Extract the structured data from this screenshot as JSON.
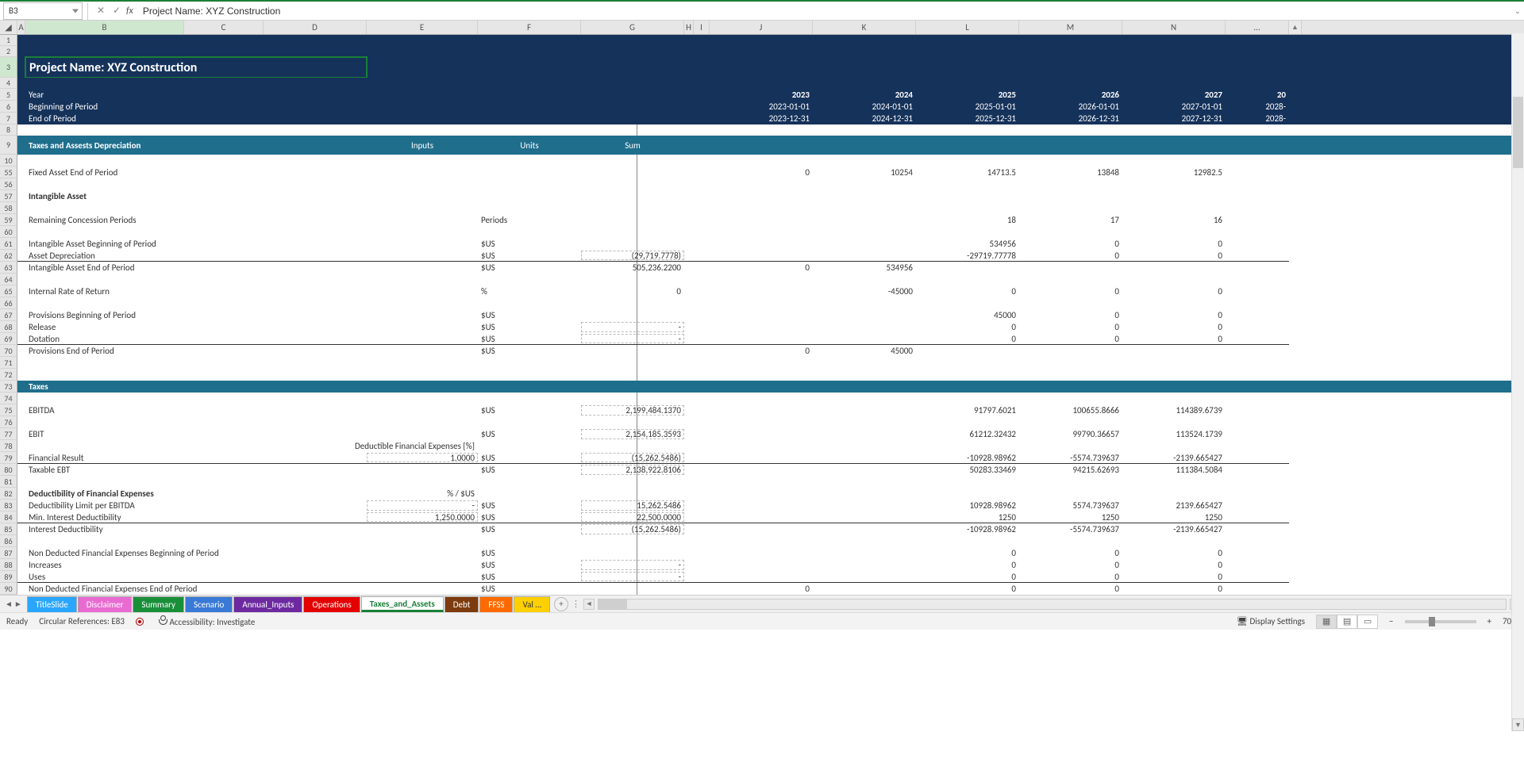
{
  "name_box": "B3",
  "formula_text": "Project Name: XYZ Construction",
  "columns": [
    "",
    "A",
    "B",
    "C",
    "D",
    "E",
    "F",
    "G",
    "H",
    "I",
    "J",
    "K",
    "L",
    "M",
    "N",
    "…"
  ],
  "header_block": {
    "title": "Project Name: XYZ Construction",
    "year_label": "Year",
    "bop_label": "Beginning of Period",
    "eop_label": "End of Period",
    "years": [
      "2023",
      "2024",
      "2025",
      "2026",
      "2027",
      "20"
    ],
    "bop": [
      "2023-01-01",
      "2024-01-01",
      "2025-01-01",
      "2026-01-01",
      "2027-01-01",
      "2028-"
    ],
    "eop": [
      "2023-12-31",
      "2024-12-31",
      "2025-12-31",
      "2026-12-31",
      "2027-12-31",
      "2028-"
    ]
  },
  "section_row": {
    "label": "Taxes and Assests Depreciation",
    "inputs": "Inputs",
    "units": "Units",
    "sum": "Sum"
  },
  "row_nums_top": [
    "1",
    "2",
    "3",
    "4",
    "5",
    "6",
    "7"
  ],
  "rows": [
    {
      "rn": "9"
    },
    {
      "rn": "10"
    },
    {
      "rn": "55",
      "b": "Fixed Asset End of Period",
      "j": "0",
      "k": "10254",
      "l": "14713.5",
      "m": "13848",
      "n": "12982.5"
    },
    {
      "rn": "56"
    },
    {
      "rn": "57",
      "b": "Intangible Asset",
      "bold": true
    },
    {
      "rn": "58"
    },
    {
      "rn": "59",
      "b": "Remaining Concession Periods",
      "f": "Periods",
      "l": "18",
      "m": "17",
      "n": "16"
    },
    {
      "rn": "60"
    },
    {
      "rn": "61",
      "b": "Intangible Asset Beginning of Period",
      "f": "$US",
      "l": "534956",
      "m": "0",
      "n": "0"
    },
    {
      "rn": "62",
      "b": "Asset Depreciation",
      "f": "$US",
      "g": "(29,719.7778)",
      "g_dot": true,
      "l": "-29719.77778",
      "m": "0",
      "n": "0",
      "underline": true
    },
    {
      "rn": "63",
      "b": "Intangible Asset End of Period",
      "f": "$US",
      "g": "505,236.2200",
      "j": "0",
      "k": "534956"
    },
    {
      "rn": "64"
    },
    {
      "rn": "65",
      "b": "Internal Rate of Return",
      "f": "%",
      "g": "0",
      "k": "-45000",
      "l": "0",
      "m": "0",
      "n": "0"
    },
    {
      "rn": "66"
    },
    {
      "rn": "67",
      "b": "Provisions Beginning of Period",
      "f": "$US",
      "l": "45000",
      "m": "0",
      "n": "0"
    },
    {
      "rn": "68",
      "b": "Release",
      "f": "$US",
      "g": "-",
      "g_dot": true,
      "l": "0",
      "m": "0",
      "n": "0"
    },
    {
      "rn": "69",
      "b": "Dotation",
      "f": "$US",
      "g": "-",
      "g_dot": true,
      "l": "0",
      "m": "0",
      "n": "0",
      "underline": true
    },
    {
      "rn": "70",
      "b": "Provisions End of Period",
      "f": "$US",
      "j": "0",
      "k": "45000"
    },
    {
      "rn": "71"
    },
    {
      "rn": "72"
    },
    {
      "rn": "73",
      "b": "Taxes",
      "teal": true
    },
    {
      "rn": "74"
    },
    {
      "rn": "75",
      "b": "EBITDA",
      "f": "$US",
      "g": "2,199,484.1370",
      "g_dot": true,
      "l": "91797.6021",
      "m": "100655.8666",
      "n": "114389.6739"
    },
    {
      "rn": "76"
    },
    {
      "rn": "77",
      "b": "EBIT",
      "f": "$US",
      "g": "2,154,185.3593",
      "g_dot": true,
      "l": "61212.32432",
      "m": "99790.36657",
      "n": "113524.1739"
    },
    {
      "rn": "78",
      "e": "Deductible Financial Expenses [%]"
    },
    {
      "rn": "79",
      "b": "Financial Result",
      "e": "1.0000",
      "e_dot": true,
      "f": "$US",
      "g": "(15,262.5486)",
      "g_dot": true,
      "l": "-10928.98962",
      "m": "-5574.739637",
      "n": "-2139.665427",
      "underline": true
    },
    {
      "rn": "80",
      "b": "Taxable EBT",
      "f": "$US",
      "g": "2,138,922.8106",
      "g_dot": true,
      "l": "50283.33469",
      "m": "94215.62693",
      "n": "111384.5084"
    },
    {
      "rn": "81"
    },
    {
      "rn": "82",
      "b": "Deductibility of Financial Expenses",
      "bold": true,
      "e": "% / $US"
    },
    {
      "rn": "83",
      "b": "Deductibility Limit per EBITDA",
      "e": "-",
      "e_dot": true,
      "f": "$US",
      "g": "15,262.5486",
      "g_dot": true,
      "l": "10928.98962",
      "m": "5574.739637",
      "n": "2139.665427"
    },
    {
      "rn": "84",
      "b": "Min. Interest Deductibility",
      "e": "1,250.0000",
      "e_dot": true,
      "f": "$US",
      "g": "22,500.0000",
      "g_dot": true,
      "l": "1250",
      "m": "1250",
      "n": "1250",
      "underline": true
    },
    {
      "rn": "85",
      "b": "Interest Deductibility",
      "f": "$US",
      "g": "(15,262.5486)",
      "g_dot": true,
      "l": "-10928.98962",
      "m": "-5574.739637",
      "n": "-2139.665427"
    },
    {
      "rn": "86"
    },
    {
      "rn": "87",
      "b": "Non Deducted Financial Expenses Beginning of Period",
      "f": "$US",
      "l": "0",
      "m": "0",
      "n": "0"
    },
    {
      "rn": "88",
      "b": "Increases",
      "f": "$US",
      "g": "-",
      "g_dot": true,
      "l": "0",
      "m": "0",
      "n": "0"
    },
    {
      "rn": "89",
      "b": "Uses",
      "f": "$US",
      "g": "-",
      "g_dot": true,
      "l": "0",
      "m": "0",
      "n": "0",
      "underline": true
    },
    {
      "rn": "90",
      "b": "Non Deducted Financial Expenses End of Period",
      "f": "$US",
      "j": "0",
      "l": "0",
      "m": "0",
      "n": "0"
    }
  ],
  "tabs": [
    {
      "label": "TitleSlide",
      "color": "#2aa6ff"
    },
    {
      "label": "Disclaimer",
      "color": "#e96bd2"
    },
    {
      "label": "Summary",
      "color": "#1a8f3a"
    },
    {
      "label": "Scenario",
      "color": "#3a7ad6"
    },
    {
      "label": "Annual_Inputs",
      "color": "#6d2aa0"
    },
    {
      "label": "Operations",
      "color": "#e30000"
    },
    {
      "label": "Taxes_and_Assets",
      "color": "#ffffff",
      "active": true
    },
    {
      "label": "Debt",
      "color": "#7d3b0e"
    },
    {
      "label": "FFSS",
      "color": "#ff6a00"
    },
    {
      "label": "Val …",
      "color": "#ffd000"
    }
  ],
  "status": {
    "ready": "Ready",
    "circular": "Circular References: E83",
    "accessibility": "Accessibility: Investigate",
    "display": "Display Settings",
    "zoom": "70%"
  }
}
